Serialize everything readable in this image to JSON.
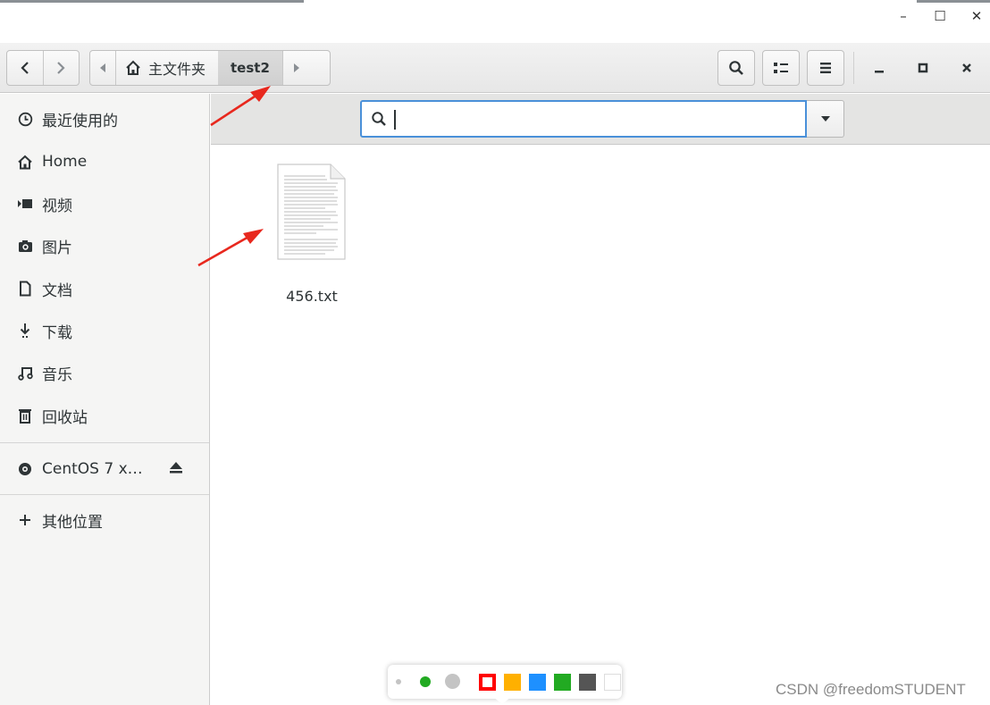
{
  "window_controls": {
    "minimize": "–",
    "maximize": "☐",
    "close": "✕"
  },
  "headerbar": {
    "breadcrumb_home": "主文件夹",
    "breadcrumb_current": "test2"
  },
  "sidebar": {
    "items": [
      {
        "label": "最近使用的",
        "icon": "clock-icon"
      },
      {
        "label": "Home",
        "icon": "home-icon"
      },
      {
        "label": "视频",
        "icon": "video-icon"
      },
      {
        "label": "图片",
        "icon": "camera-icon"
      },
      {
        "label": "文档",
        "icon": "document-icon"
      },
      {
        "label": "下载",
        "icon": "download-icon"
      },
      {
        "label": "音乐",
        "icon": "music-icon"
      },
      {
        "label": "回收站",
        "icon": "trash-icon"
      }
    ],
    "device": {
      "label": "CentOS 7 x…",
      "icon": "disc-icon",
      "action_icon": "eject-icon"
    },
    "other_locations": {
      "label": "其他位置",
      "icon": "plus-icon"
    }
  },
  "search": {
    "value": ""
  },
  "files": [
    {
      "name": "456.txt",
      "icon": "text-file-icon"
    }
  ],
  "annotation_toolbar": {
    "colors": [
      "#ff0000",
      "#ffb000",
      "#1e90ff",
      "#22aa22",
      "#555555",
      "#ffffff"
    ]
  },
  "watermark": "CSDN @freedomSTUDENT"
}
